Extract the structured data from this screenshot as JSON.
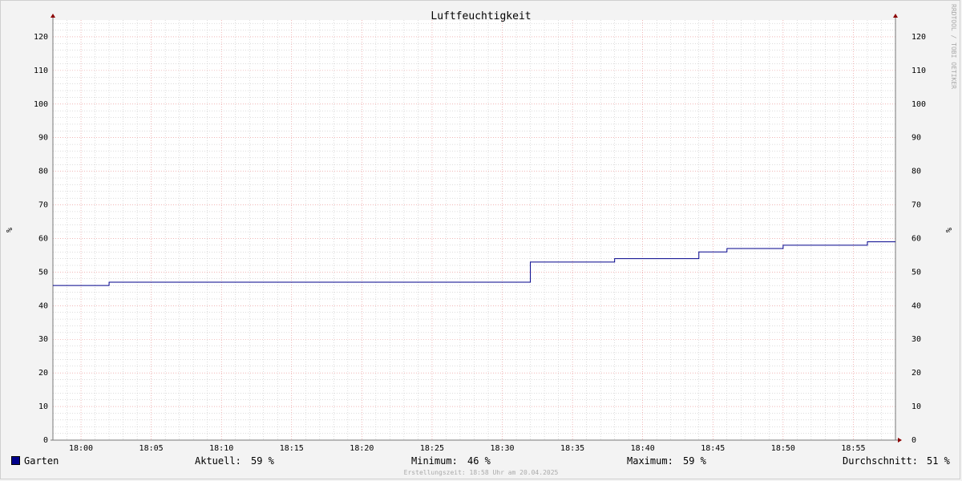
{
  "chart_data": {
    "type": "line",
    "title": "Luftfeuchtigkeit",
    "ylabel": "%",
    "ylabel_right": "%",
    "ylim": [
      0,
      125
    ],
    "yticks": [
      0,
      10,
      20,
      30,
      40,
      50,
      60,
      70,
      80,
      90,
      100,
      110,
      120
    ],
    "xlim_minutes": [
      "17:58",
      "18:58"
    ],
    "xticks": [
      "18:00",
      "18:05",
      "18:10",
      "18:15",
      "18:20",
      "18:25",
      "18:30",
      "18:35",
      "18:40",
      "18:45",
      "18:50",
      "18:55"
    ],
    "grid": true,
    "series": [
      {
        "name": "Garten",
        "color": "#00008b",
        "step": true,
        "points": [
          [
            "17:58",
            46
          ],
          [
            "18:02",
            47
          ],
          [
            "18:32",
            53
          ],
          [
            "18:38",
            54
          ],
          [
            "18:44",
            56
          ],
          [
            "18:46",
            57
          ],
          [
            "18:50",
            58
          ],
          [
            "18:56",
            59
          ],
          [
            "18:58",
            59
          ]
        ]
      }
    ]
  },
  "legend": {
    "series_name": "Garten",
    "swatch_color": "#00008b",
    "current_label": "Aktuell:",
    "current_value": "59 %",
    "min_label": "Minimum:",
    "min_value": "46 %",
    "max_label": "Maximum:",
    "max_value": "59 %",
    "avg_label": "Durchschnitt:",
    "avg_value": "51 %"
  },
  "watermark": "RRDTOOL / TOBI OETIKER",
  "footer": "Erstellungszeit: 18:58 Uhr am 20.04.2025",
  "colors": {
    "major_grid": "#e88a8a",
    "minor_grid": "#bbbbbb",
    "axis": "#777777",
    "arrow": "#8b0000",
    "plot_bg": "#ffffff"
  }
}
